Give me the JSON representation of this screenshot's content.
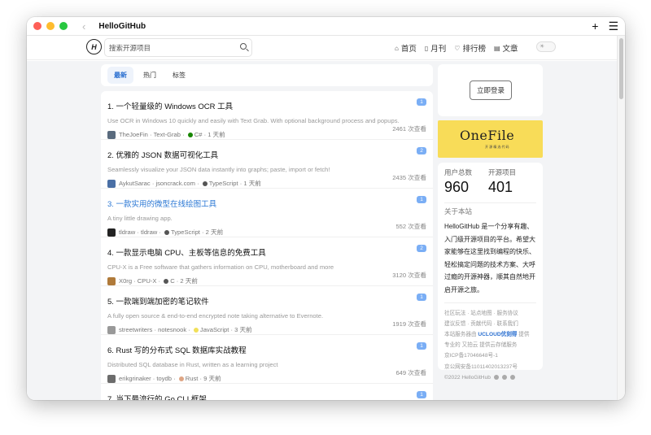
{
  "window": {
    "title": "HelloGitHub"
  },
  "navbar": {
    "logo_text": "H",
    "search_placeholder": "搜索开源项目",
    "links": [
      {
        "icon": "home-icon",
        "glyph": "⌂",
        "label": "首页"
      },
      {
        "icon": "book-icon",
        "glyph": "▯",
        "label": "月刊"
      },
      {
        "icon": "trophy-icon",
        "glyph": "♡",
        "label": "排行榜"
      },
      {
        "icon": "article-icon",
        "glyph": "▤",
        "label": "文章"
      }
    ],
    "theme_toggle_glyph": "☀"
  },
  "tabs": [
    "最新",
    "热门",
    "标签"
  ],
  "items": [
    {
      "title": "1. 一个轻量级的 Windows OCR 工具",
      "desc": "Use OCR in Windows 10 quickly and easily with Text Grab. With optional background process and popups.",
      "author": "TheJoeFin",
      "repo": "Text-Grab",
      "lang": "C#",
      "lang_color": "#178600",
      "time": "1 天前",
      "badge": "1",
      "views": "2461 次查看",
      "avatar_color": "#5a6b7e"
    },
    {
      "title": "2. 优雅的 JSON 数据可视化工具",
      "desc": "Seamlessly visualize your JSON data instantly into graphs; paste, import or fetch!",
      "author": "AykutSarac",
      "repo": "jsoncrack.com",
      "lang": "TypeScript",
      "lang_color": "#555",
      "time": "1 天前",
      "badge": "2",
      "views": "2435 次查看",
      "avatar_color": "#4a6fa5"
    },
    {
      "title": "3. 一款实用的微型在线绘图工具",
      "desc": "A tiny little drawing app.",
      "author": "tldraw",
      "repo": "tldraw",
      "lang": "TypeScript",
      "lang_color": "#555",
      "time": "2 天前",
      "badge": "1",
      "views": "552 次查看",
      "avatar_color": "#222"
    },
    {
      "title": "4. 一款显示电脑 CPU、主板等信息的免费工具",
      "desc": "CPU-X is a Free software that gathers information on CPU, motherboard and more",
      "author": "X0rg",
      "repo": "CPU-X",
      "lang": "C",
      "lang_color": "#555",
      "time": "2 天前",
      "badge": "2",
      "views": "3120 次查看",
      "avatar_color": "#b07a3a"
    },
    {
      "title": "5. 一款端到端加密的笔记软件",
      "desc": "A fully open source & end-to-end encrypted note taking alternative to Evernote.",
      "author": "streetwriters",
      "repo": "notesnook",
      "lang": "JavaScript",
      "lang_color": "#f1e05a",
      "time": "3 天前",
      "badge": "1",
      "views": "1919 次查看",
      "avatar_color": "#999"
    },
    {
      "title": "6. Rust 写的分布式 SQL 数据库实战教程",
      "desc": "Distributed SQL database in Rust, written as a learning project",
      "author": "erikgrinaker",
      "repo": "toydb",
      "lang": "Rust",
      "lang_color": "#dea584",
      "time": "9 天前",
      "badge": "1",
      "views": "649 次查看",
      "avatar_color": "#6c6c6c"
    },
    {
      "title": "7. 当下最流行的 Go CLI 框架",
      "desc": "",
      "author": "",
      "repo": "",
      "lang": "",
      "lang_color": "#555",
      "time": "",
      "badge": "1",
      "views": "",
      "avatar_color": "#6c6c6c"
    }
  ],
  "sidebar": {
    "login_label": "立即登录",
    "banner_title": "OneFile",
    "banner_sub": "开 源 精 选 代 码",
    "stats": [
      {
        "label": "用户总数",
        "value": "960"
      },
      {
        "label": "开源项目",
        "value": "401"
      }
    ],
    "about_heading": "关于本站",
    "about_text": "HelloGitHub 是一个分享有趣、入门级开源项目的平台。希望大家能够在这里找到编程的快乐、轻松搞定问题的技术方案、大呼过瘾的开源神器，顺其自然地开启开源之旅。",
    "footer": {
      "line1": "社区玩法 · 站点地图 · 服务协议",
      "line2": "建议反馈 · 贡献代码 · 联系我们",
      "line3_prefix": "本站服务器由",
      "line3_brand": "UCLOUD优刻得",
      "line3_suffix": "提供",
      "line4": "专业的 又拍云 提供云存储服务",
      "line5": "京ICP备17046648号-1",
      "line6": "京公网安备11011402013237号",
      "line7": "©2022 HelloGitHub"
    }
  }
}
